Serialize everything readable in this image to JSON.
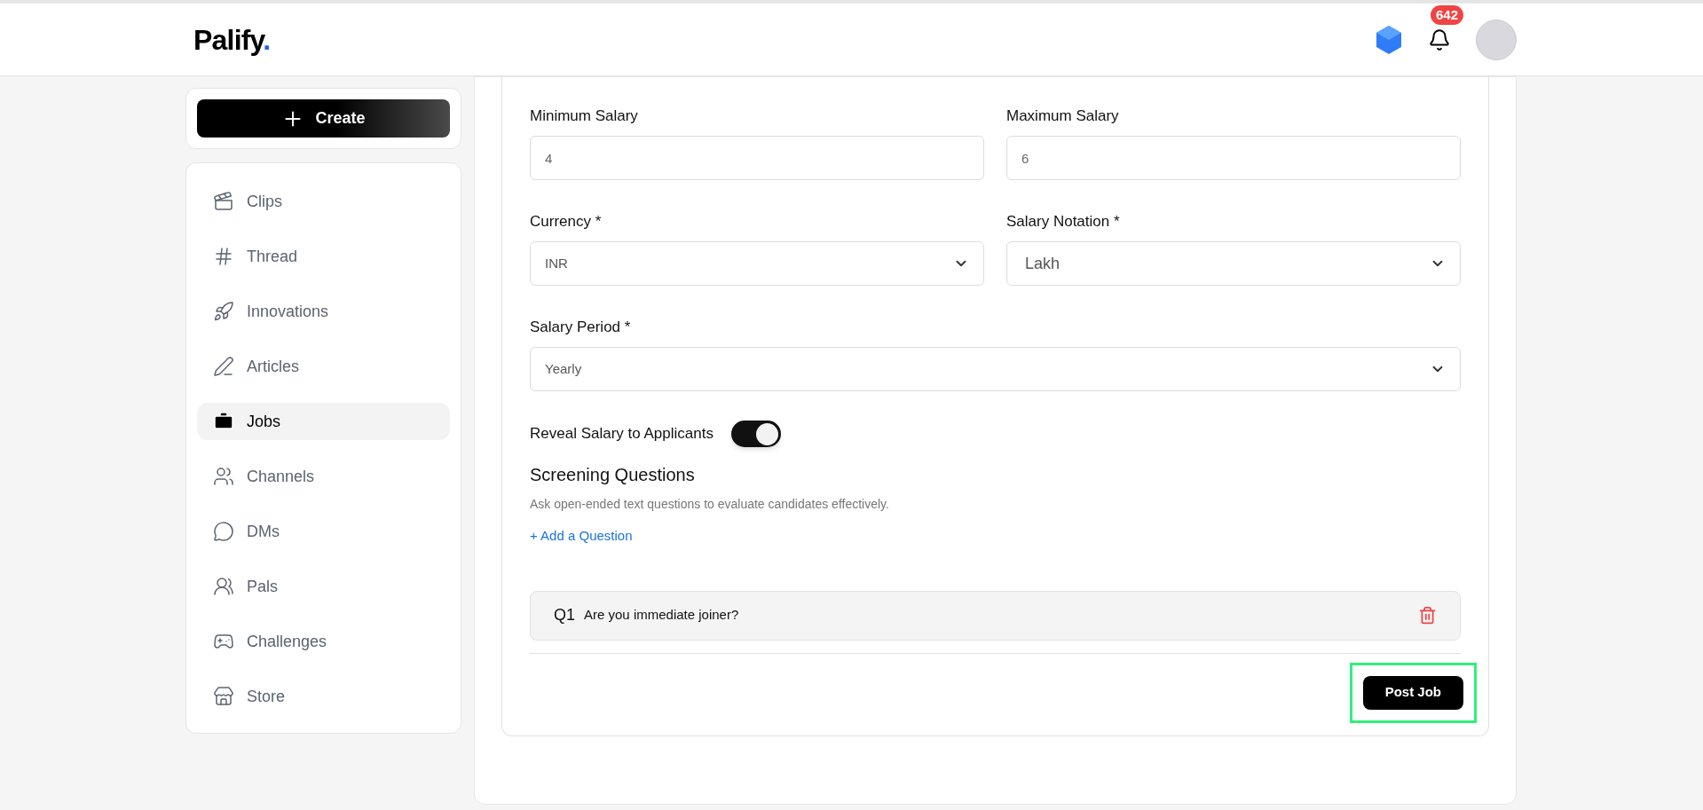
{
  "header": {
    "logo": "Palify",
    "logo_dot": ".",
    "notifications": {
      "count": "642"
    }
  },
  "sidebar": {
    "create_button": "Create",
    "items": [
      {
        "label": "Clips",
        "kind": "clips",
        "selected": false
      },
      {
        "label": "Thread",
        "kind": "thread",
        "selected": false
      },
      {
        "label": "Innovations",
        "kind": "innovations",
        "selected": false
      },
      {
        "label": "Articles",
        "kind": "articles",
        "selected": false
      },
      {
        "label": "Jobs",
        "kind": "jobs",
        "selected": true
      },
      {
        "label": "Channels",
        "kind": "channels",
        "selected": false
      },
      {
        "label": "DMs",
        "kind": "dms",
        "selected": false
      },
      {
        "label": "Pals",
        "kind": "pals",
        "selected": false
      },
      {
        "label": "Challenges",
        "kind": "challenges",
        "selected": false
      },
      {
        "label": "Store",
        "kind": "store",
        "selected": false
      }
    ]
  },
  "form": {
    "rows": [
      [
        {
          "label": "Minimum Salary",
          "kind": "input",
          "value": "4"
        },
        {
          "label": "Maximum Salary",
          "kind": "input",
          "value": "6"
        }
      ],
      [
        {
          "label": "Currency *",
          "kind": "select",
          "value": "INR"
        },
        {
          "label": "Salary Notation *",
          "kind": "select-large",
          "value": "Lakh"
        }
      ],
      [
        {
          "label": "Salary Period *",
          "kind": "select",
          "value": "Yearly"
        }
      ]
    ],
    "reveal_salary": {
      "label": "Reveal Salary to Applicants",
      "on": true
    },
    "screening": {
      "title": "Screening Questions",
      "description": "Ask open-ended text questions to evaluate candidates effectively.",
      "add_link": "+ Add a Question",
      "questions": [
        {
          "number": "Q1",
          "text": "Are you immediate joiner?"
        }
      ]
    },
    "submit_button": "Post Job"
  }
}
